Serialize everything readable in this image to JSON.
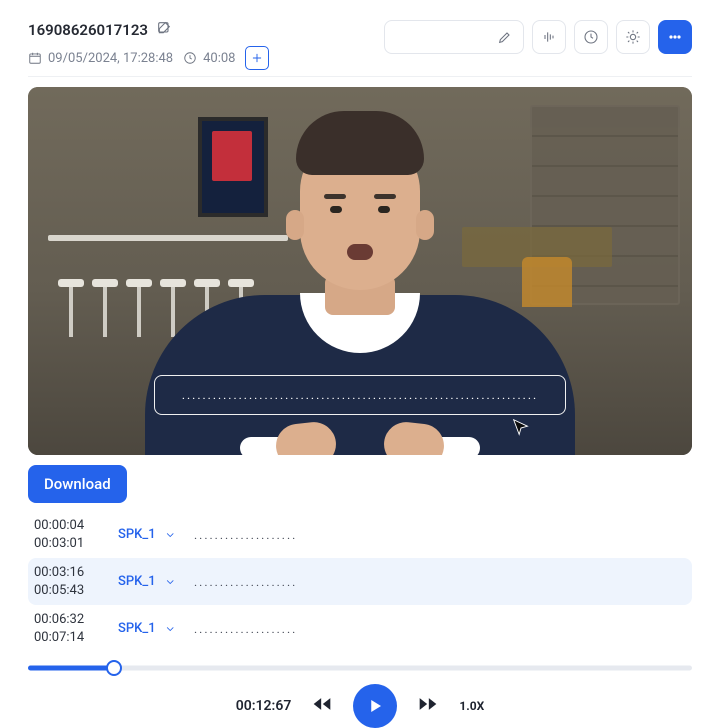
{
  "header": {
    "title": "16908626017123",
    "date": "09/05/2024, 17:28:48",
    "duration": "40:08"
  },
  "caption_placeholder": ".....................................................................",
  "download_label": "Download",
  "transcript": [
    {
      "start": "00:00:04",
      "end": "00:03:01",
      "speaker": "SPK_1",
      "text": "....................",
      "selected": false
    },
    {
      "start": "00:03:16",
      "end": "00:05:43",
      "speaker": "SPK_1",
      "text": "....................",
      "selected": true
    },
    {
      "start": "00:06:32",
      "end": "00:07:14",
      "speaker": "SPK_1",
      "text": "....................",
      "selected": false
    }
  ],
  "player": {
    "current_time": "00:12:67",
    "rate": "1.0X",
    "progress_percent": 13
  }
}
